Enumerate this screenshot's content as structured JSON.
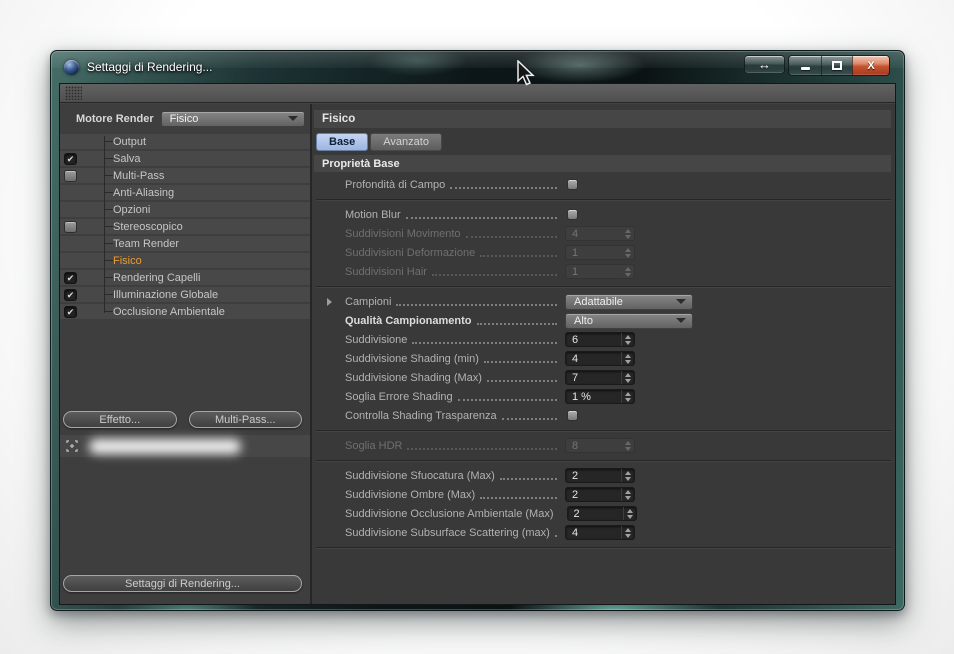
{
  "window": {
    "title": "Settaggi di Rendering...",
    "controls": {
      "resize_glyph": "↔",
      "close_glyph": "X"
    }
  },
  "sidebar": {
    "engine_label": "Motore Render",
    "engine_value": "Fisico",
    "items": [
      {
        "label": "Output",
        "check": "none",
        "selected": false
      },
      {
        "label": "Salva",
        "check": "checked",
        "selected": false
      },
      {
        "label": "Multi-Pass",
        "check": "unchecked",
        "selected": false
      },
      {
        "label": "Anti-Aliasing",
        "check": "none",
        "selected": false
      },
      {
        "label": "Opzioni",
        "check": "none",
        "selected": false
      },
      {
        "label": "Stereoscopico",
        "check": "unchecked",
        "selected": false
      },
      {
        "label": "Team Render",
        "check": "none",
        "selected": false
      },
      {
        "label": "Fisico",
        "check": "none",
        "selected": true
      },
      {
        "label": "Rendering Capelli",
        "check": "checked",
        "selected": false
      },
      {
        "label": "Illuminazione Globale",
        "check": "checked",
        "selected": false
      },
      {
        "label": "Occlusione Ambientale",
        "check": "checked",
        "selected": false
      }
    ],
    "effect_button": "Effetto...",
    "multipass_button": "Multi-Pass...",
    "settings_button": "Settaggi di Rendering..."
  },
  "panel": {
    "title": "Fisico",
    "tabs": [
      {
        "label": "Base",
        "active": true
      },
      {
        "label": "Avanzato",
        "active": false
      }
    ],
    "section": "Proprietà Base",
    "rows": [
      {
        "type": "checkbox",
        "label": "Profondità di Campo",
        "checked": false
      },
      {
        "type": "separator"
      },
      {
        "type": "checkbox",
        "label": "Motion Blur",
        "checked": false
      },
      {
        "type": "spinner",
        "label": "Suddivisioni Movimento",
        "value": "4",
        "disabled": true
      },
      {
        "type": "spinner",
        "label": "Suddivisioni Deformazione",
        "value": "1",
        "disabled": true
      },
      {
        "type": "spinner",
        "label": "Suddivisioni Hair",
        "value": "1",
        "disabled": true
      },
      {
        "type": "separator"
      },
      {
        "type": "dropdown",
        "label": "Campioni",
        "value": "Adattabile",
        "arrow": true
      },
      {
        "type": "dropdown",
        "label": "Qualità Campionamento",
        "value": "Alto",
        "bold": true
      },
      {
        "type": "spinner",
        "label": "Suddivisione",
        "value": "6"
      },
      {
        "type": "spinner",
        "label": "Suddivisione Shading (min)",
        "value": "4"
      },
      {
        "type": "spinner",
        "label": "Suddivisione Shading (Max)",
        "value": "7"
      },
      {
        "type": "spinner",
        "label": "Soglia Errore Shading",
        "value": "1 %"
      },
      {
        "type": "checkbox",
        "label": "Controlla Shading Trasparenza",
        "checked": false
      },
      {
        "type": "separator"
      },
      {
        "type": "spinner",
        "label": "Soglia HDR",
        "value": "8",
        "disabled": true
      },
      {
        "type": "separator"
      },
      {
        "type": "spinner",
        "label": "Suddivisione Sfuocatura (Max)",
        "value": "2"
      },
      {
        "type": "spinner",
        "label": "Suddivisione Ombre (Max)",
        "value": "2"
      },
      {
        "type": "spinner",
        "label": "Suddivisione Occlusione Ambientale (Max)",
        "value": "2"
      },
      {
        "type": "spinner",
        "label": "Suddivisione Subsurface Scattering (max)",
        "value": "4"
      },
      {
        "type": "separator"
      }
    ]
  },
  "colors": {
    "selected_item": "#eb9d2e",
    "active_tab": "#a9c3ea",
    "close_button": "#c4532f",
    "client_bg": "#3e3e3e"
  }
}
